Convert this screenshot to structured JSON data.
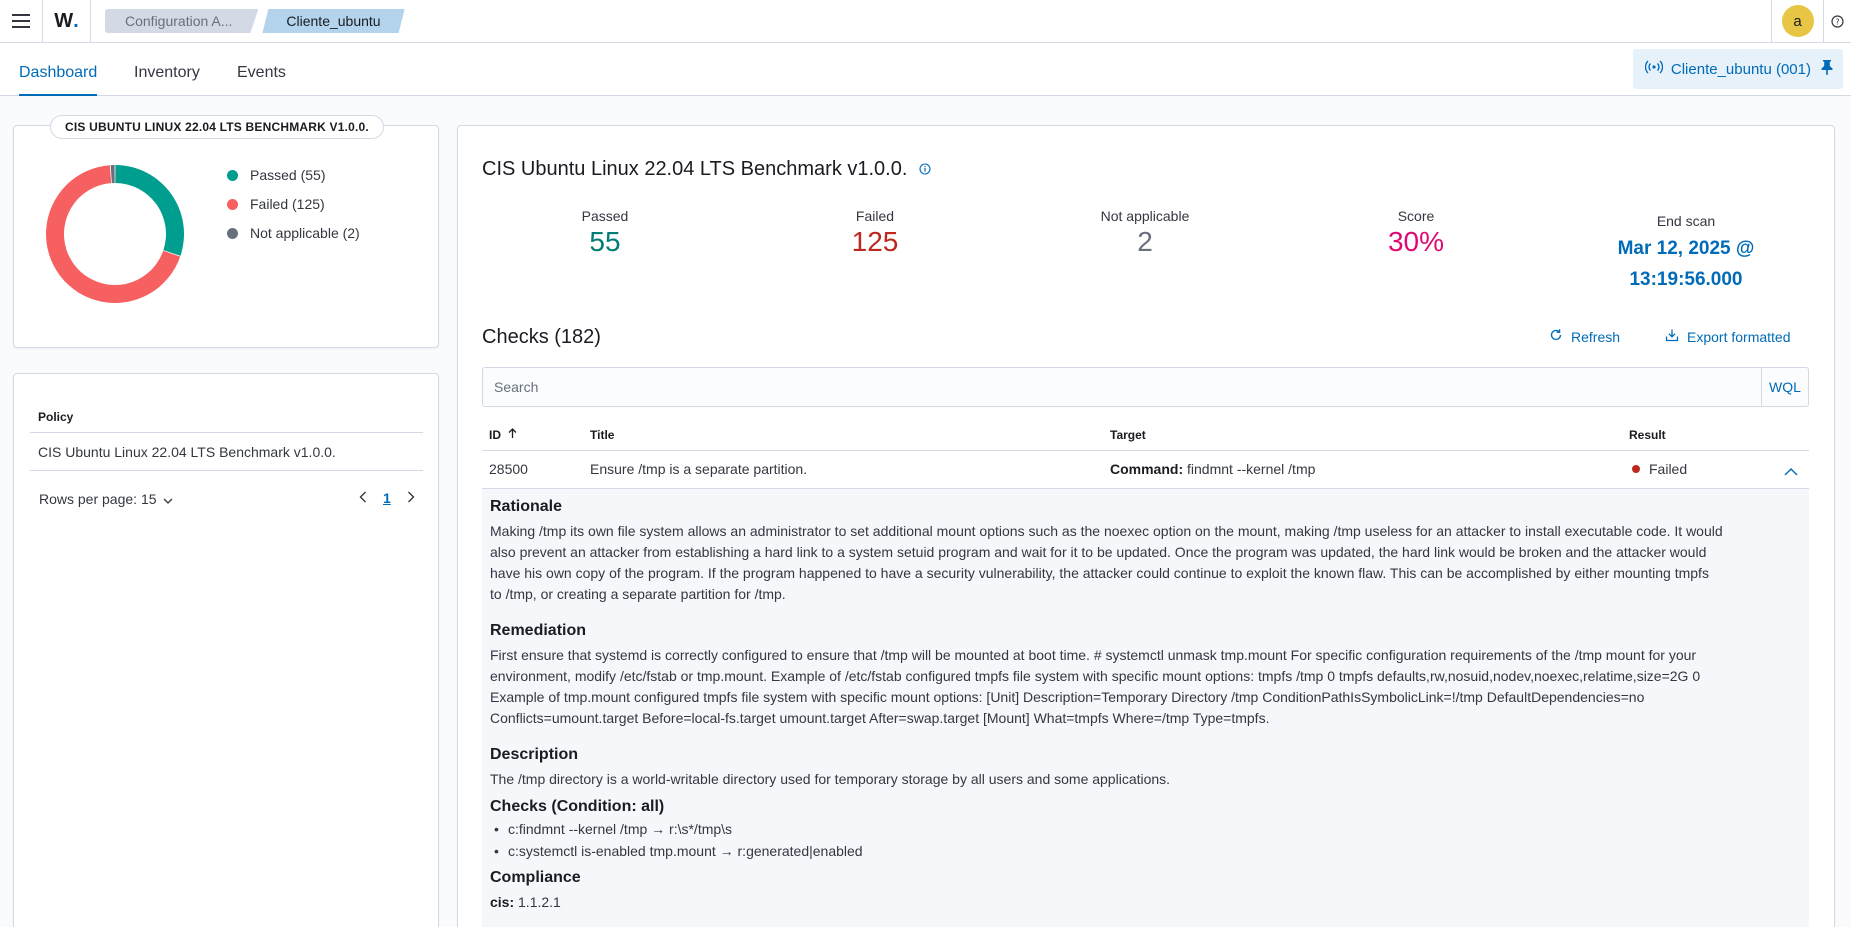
{
  "breadcrumbs": [
    "Configuration A...",
    "Cliente_ubuntu"
  ],
  "user": {
    "avatar_letter": "a"
  },
  "tabs": [
    "Dashboard",
    "Inventory",
    "Events"
  ],
  "agent": {
    "label": "Cliente_ubuntu (001)"
  },
  "summary_card": {
    "title": "CIS UBUNTU LINUX 22.04 LTS BENCHMARK V1.0.0.",
    "legend": [
      {
        "label": "Passed (55)",
        "color": "#009e8f"
      },
      {
        "label": "Failed (125)",
        "color": "#f66060"
      },
      {
        "label": "Not applicable (2)",
        "color": "#69707d"
      }
    ]
  },
  "chart_data": {
    "type": "pie",
    "donut": true,
    "categories": [
      "Passed",
      "Failed",
      "Not applicable"
    ],
    "values": [
      55,
      125,
      2
    ],
    "colors": [
      "#009e8f",
      "#f66060",
      "#69707d"
    ]
  },
  "policy_table": {
    "header": "Policy",
    "rows": [
      "CIS Ubuntu Linux 22.04 LTS Benchmark v1.0.0."
    ],
    "rows_per_page_label": "Rows per page: 15",
    "current_page": "1"
  },
  "main": {
    "title": "CIS Ubuntu Linux 22.04 LTS Benchmark v1.0.0.",
    "stats": {
      "passed_label": "Passed",
      "passed_value": "55",
      "failed_label": "Failed",
      "failed_value": "125",
      "na_label": "Not applicable",
      "na_value": "2",
      "score_label": "Score",
      "score_value": "30%",
      "end_label": "End scan",
      "end_line1": "Mar 12, 2025 @",
      "end_line2": "13:19:56.000"
    },
    "checks_title": "Checks (182)",
    "refresh_label": "Refresh",
    "export_label": "Export formatted",
    "search_placeholder": "Search",
    "wql_label": "WQL",
    "columns": {
      "id": "ID",
      "title": "Title",
      "target": "Target",
      "result": "Result"
    },
    "row": {
      "id": "28500",
      "title": "Ensure /tmp is a separate partition.",
      "target_key": "Command:",
      "target_value": " findmnt --kernel /tmp",
      "result": "Failed"
    },
    "details": {
      "rationale_h": "Rationale",
      "rationale_lines": [
        "Making /tmp its own file system allows an administrator to set additional mount options such as the noexec option on the mount, making /tmp useless for an attacker to install executable code. It would",
        "also prevent an attacker from establishing a hard link to a system setuid program and wait for it to be updated. Once the program was updated, the hard link would be broken and the attacker would",
        "have his own copy of the program. If the program happened to have a security vulnerability, the attacker could continue to exploit the known flaw. This can be accomplished by either mounting tmpfs",
        "to /tmp, or creating a separate partition for /tmp."
      ],
      "remediation_h": "Remediation",
      "remediation_lines": [
        "First ensure that systemd is correctly configured to ensure that /tmp will be mounted at boot time. # systemctl unmask tmp.mount For specific configuration requirements of the /tmp mount for your",
        "environment, modify /etc/fstab or tmp.mount. Example of /etc/fstab configured tmpfs file system with specific mount options: tmpfs /tmp 0 tmpfs defaults,rw,nosuid,nodev,noexec,relatime,size=2G 0",
        "Example of tmp.mount configured tmpfs file system with specific mount options: [Unit] Description=Temporary Directory /tmp ConditionPathIsSymbolicLink=!/tmp DefaultDependencies=no",
        "Conflicts=umount.target Before=local-fs.target umount.target After=swap.target [Mount] What=tmpfs Where=/tmp Type=tmpfs."
      ],
      "description_h": "Description",
      "description": "The /tmp directory is a world-writable directory used for temporary storage by all users and some applications.",
      "checks_h": "Checks (Condition: all)",
      "checks": [
        "c:findmnt --kernel /tmp → r:\\s*/tmp\\s",
        "c:systemctl is-enabled tmp.mount → r:generated|enabled"
      ],
      "compliance_h": "Compliance",
      "compliance_key": "cis:",
      "compliance_value": " 1.1.2.1"
    }
  }
}
